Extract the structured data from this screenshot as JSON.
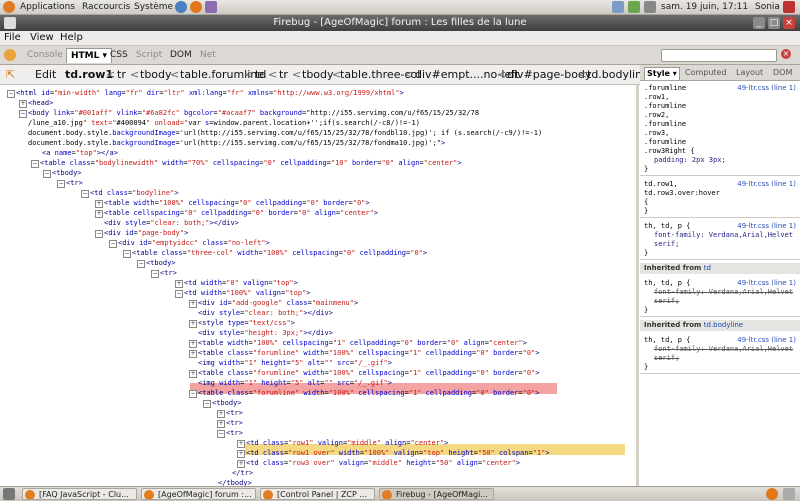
{
  "panel": {
    "menus": [
      "Applications",
      "Raccourcis",
      "Système"
    ],
    "date": "sam. 19 juin, 17:11",
    "user": "Sonia"
  },
  "window": {
    "title": "Firebug - [AgeOfMagic] forum : Les filles de la lune"
  },
  "menubar": [
    "File",
    "View",
    "Help"
  ],
  "firebug_tabs": [
    "Console",
    "HTML",
    "CSS",
    "Script",
    "DOM",
    "Net"
  ],
  "breadcrumb": {
    "edit": "Edit",
    "items": [
      "td.row1",
      "tr",
      "tbody",
      "table.forumline",
      "td",
      "tr",
      "tbody",
      "table.three-col",
      "div#empt....no-left",
      "div#page-body",
      "td.bodyline"
    ]
  },
  "side_tabs": [
    "Style",
    "Computed",
    "Layout",
    "DOM"
  ],
  "html_lines": [
    "<html id=\"min-width\" lang=\"fr\" dir=\"ltr\" xml:lang=\"fr\" xmlns=\"http://www.w3.org/1999/xhtml\">",
    "<head>",
    "<body link=\"#001aff\" vlink=\"#6a82fc\" bgcolor=\"#acaaf7\" background=\"http://i55.servimg.com/u/f65/15/25/32/78",
    "/lune_a10.jpg\" text=\"#400094\" onload=\"var s=window.parent.location+'';if(s.search(/-c8/)!=-1)",
    "document.body.style.backgroundImage='url(http://i55.servimg.com/u/f65/15/25/32/78/fondbl10.jpg)'; if (s.search(/-c9/)!=-1)",
    "document.body.style.backgroundImage='url(http://i55.servimg.com/u/f65/15/25/32/78/fondma10.jpg)';\">",
    "<a name=\"top\"></a>",
    "<table class=\"bodylinewidth\" width=\"70%\" cellspacing=\"0\" cellpadding=\"10\" border=\"0\" align=\"center\">",
    "<tbody>",
    "<tr>",
    "<td class=\"bodyline\">",
    "<table width=\"100%\" cellspacing=\"0\" cellpadding=\"0\" border=\"0\">",
    "<table cellspacing=\"0\" cellpadding=\"0\" border=\"0\" align=\"center\">",
    "<div style=\"clear: both;\"></div>",
    "<div id=\"page-body\">",
    "<div id=\"emptyidcc\" class=\"no-left\">",
    "<table class=\"three-col\" width=\"100%\" cellspacing=\"0\" cellpadding=\"0\">",
    "<tbody>",
    "<tr>",
    "<td width=\"0\" valign=\"top\">",
    "<td width=\"100%\" valign=\"top\">",
    "<div id=\"add-google\" class=\"mainmenu\">",
    "<div style=\"clear: both;\"></div>",
    "<style type=\"text/css\">",
    "<div style=\"height: 3px;\"></div>",
    "<table width=\"100%\" cellspacing=\"1\" cellpadding=\"0\" border=\"0\" align=\"center\">",
    "<table class=\"forumline\" width=\"100%\" cellspacing=\"1\" cellpadding=\"0\" border=\"0\">",
    "<img width=\"1\" height=\"5\" alt=\"\" src=\"/_.gif\">",
    "<table class=\"forumline\" width=\"100%\" cellspacing=\"1\" cellpadding=\"0\" border=\"0\">",
    "<img width=\"1\" height=\"5\" alt=\"\" src=\"/_.gif\">",
    "<table class=\"forumline\" width=\"100%\" cellspacing=\"1\" cellpadding=\"0\" border=\"0\">",
    "<tbody>",
    "<tr>",
    "<tr>",
    "<tr>",
    "<td class=\"row1\" valign=\"middle\" align=\"center\">",
    "<td class=\"row1 over\" width=\"100%\" valign=\"top\" height=\"50\" colspan=\"1\">",
    "<td class=\"row3 over\" valign=\"middle\" height=\"50\" align=\"center\">",
    "</tr>",
    "</tbody>"
  ],
  "style_rules": [
    {
      "selector": [
        ".forumline",
        ".row1,",
        ".forumline",
        ".row2,",
        ".forumline",
        ".row3,",
        ".forumline",
        ".row3Right {"
      ],
      "source": "49-ltr.css (line 1)",
      "props": [
        "padding: 2px 3px;"
      ],
      "close": "}"
    },
    {
      "selector": [
        "td.row1,",
        "td.row3.over:hover",
        "{"
      ],
      "source": "49-ltr.css (line 1)",
      "props": [],
      "close": "}"
    },
    {
      "selector": [
        "th, td, p {"
      ],
      "source": "49-ltr.css (line 1)",
      "props": [
        "font-family: Verdana,Arial,Helvet",
        "serif;"
      ],
      "close": "}"
    }
  ],
  "inherited": [
    {
      "label": "Inherited from",
      "element": "td",
      "selector": "th, td, p {",
      "source": "49-ltr.css (line 1)",
      "props": [
        "font-family: Verdana,Arial,Helvet",
        "serif;"
      ],
      "close": "}"
    },
    {
      "label": "Inherited from",
      "element": "td.bodyline",
      "selector": "th, td, p {",
      "source": "49-ltr.css (line 1)",
      "props": [
        "font-family: Verdana,Arial,Helvet",
        "serif;"
      ],
      "close": "}"
    }
  ],
  "taskbar": [
    {
      "label": "[FAQ JavaScript - Clu..."
    },
    {
      "label": "[AgeOfMagic] forum :..."
    },
    {
      "label": "[Control Panel | ZCP ..."
    },
    {
      "label": "Firebug - [AgeOfMagi..."
    }
  ],
  "colors": {
    "selected_node": "#f4a3a3",
    "hover_node": "#f5d882",
    "link": "#2a4fb8"
  }
}
